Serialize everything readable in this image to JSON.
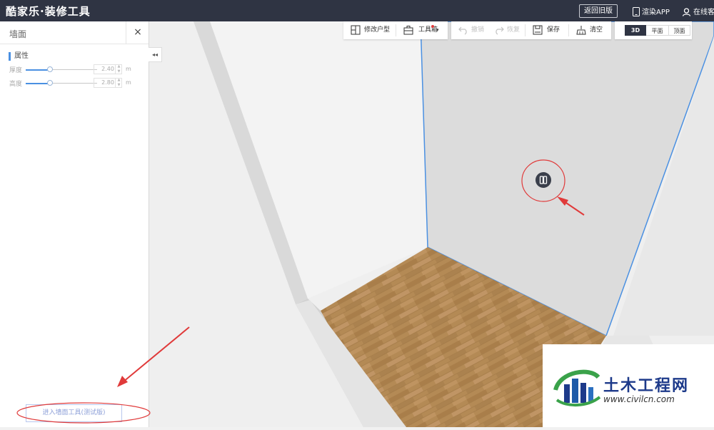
{
  "topbar": {
    "logo": "酷家乐·装修工具",
    "old_version": "返回旧版",
    "render_app": "渲染APP",
    "customer_service": "在线客"
  },
  "panel": {
    "title": "墙面",
    "close": "×",
    "collapse": "◂◂",
    "section": "属性",
    "props": [
      {
        "label": "厚度",
        "value": "2.40",
        "unit": "m",
        "slider_fraction": 0.34
      },
      {
        "label": "高度",
        "value": "2.80",
        "unit": "m",
        "slider_fraction": 0.34
      }
    ],
    "enter_button": "进入墙面工具(测试版)"
  },
  "toolbar": {
    "modify_layout": "修改户型",
    "toolbox": "工具箱",
    "undo": "撤销",
    "redo": "恢复",
    "save": "保存",
    "clear": "清空"
  },
  "views": {
    "v3d": "3D",
    "plan": "平面",
    "ceiling": "顶面",
    "active": "3D"
  },
  "watermark": {
    "title": "土木工程网",
    "url": "www.civilcn.com"
  },
  "colors": {
    "topbar": "#2f3443",
    "accent": "#4a90e2",
    "wall_outline": "#4a90e2",
    "annotation": "#e03a3a",
    "floor_wood": "#b48a55"
  }
}
